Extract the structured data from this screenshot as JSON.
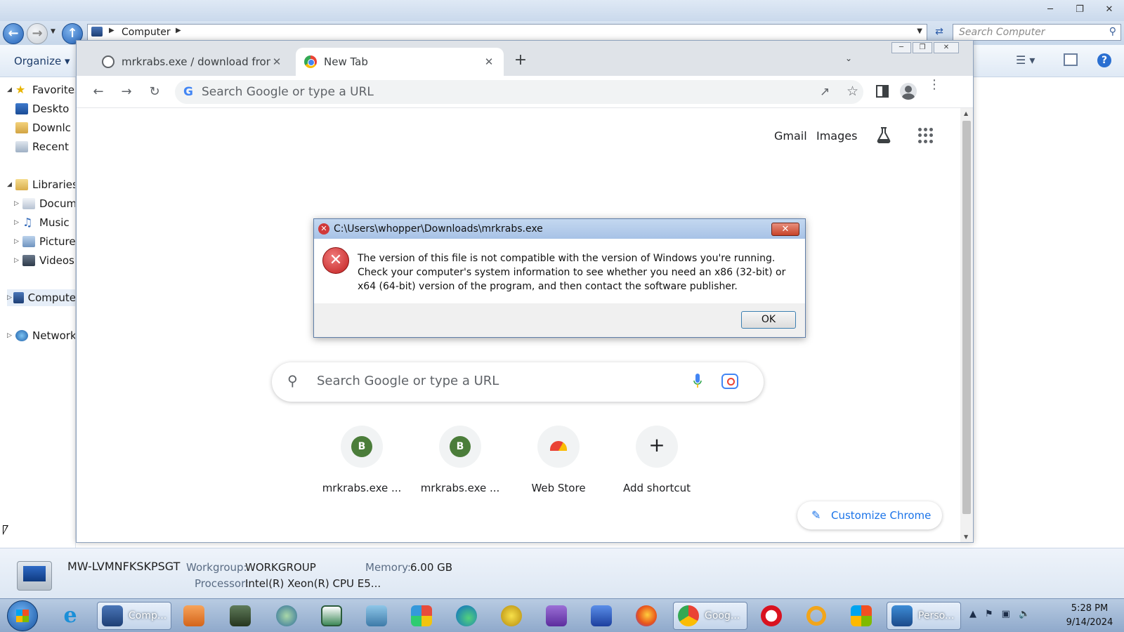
{
  "explorer": {
    "breadcrumb": "Computer",
    "search_placeholder": "Search Computer",
    "toolbar": {
      "organize_label": "Organize ▾"
    },
    "nav": {
      "favorites": "Favorites",
      "desktop": "Deskto",
      "downloads": "Downlc",
      "recent": "Recent",
      "libraries": "Libraries",
      "documents": "Docum",
      "music": "Music",
      "pictures": "Pictures",
      "videos": "Videos",
      "computer": "Compute",
      "network": "Network"
    },
    "details": {
      "computer_name": "MW-LVMNFKSKPSGT",
      "workgroup_label": "Workgroup:",
      "workgroup_value": "WORKGROUP",
      "memory_label": "Memory:",
      "memory_value": "6.00 GB",
      "processor_label": "Processor:",
      "processor_value": "Intel(R) Xeon(R) CPU E5..."
    }
  },
  "chrome": {
    "tabs": [
      {
        "title": "mrkrabs.exe / download from ba",
        "close": "✕"
      },
      {
        "title": "New Tab",
        "close": "✕"
      }
    ],
    "new_tab_symbol": "+",
    "omnibox_placeholder": "Search Google or type a URL",
    "ntp": {
      "gmail": "Gmail",
      "images": "Images",
      "search_placeholder": "Search Google or type a URL",
      "shortcuts": [
        {
          "letter": "B",
          "label": "mrkrabs.exe ..."
        },
        {
          "letter": "B",
          "label": "mrkrabs.exe ..."
        },
        {
          "letter": "",
          "label": "Web Store"
        },
        {
          "letter": "+",
          "label": "Add shortcut"
        }
      ],
      "customize_label": "Customize Chrome"
    }
  },
  "dialog": {
    "title": "C:\\Users\\whopper\\Downloads\\mrkrabs.exe",
    "message": "The version of this file is not compatible with the version of Windows you're running. Check your computer's system information to see whether you need an x86 (32-bit) or x64 (64-bit) version of the program, and then contact the software publisher.",
    "ok_label": "OK"
  },
  "taskbar": {
    "explorer_label": "Comp...",
    "chrome_label": "Goog...",
    "personal_label": "Perso...",
    "time": "5:28 PM",
    "date": "9/14/2024"
  },
  "colors": {
    "chrome_blue": "#1a73e8",
    "error_red": "#c11f1f",
    "shortcut_green": "#4b7d3a"
  }
}
